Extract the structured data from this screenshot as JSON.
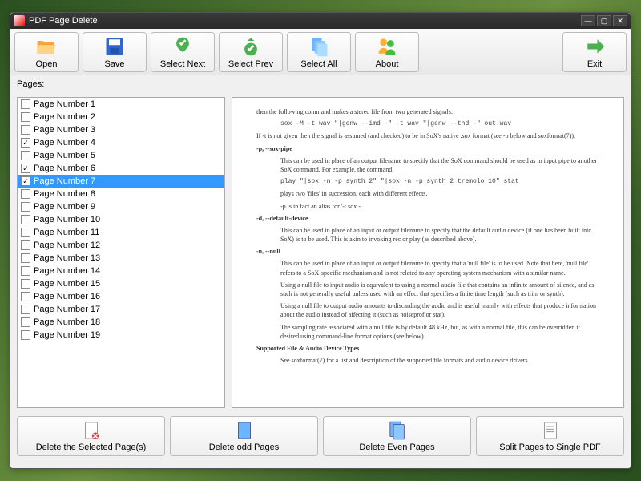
{
  "window": {
    "title": "PDF Page Delete"
  },
  "toolbar": {
    "open": "Open",
    "save": "Save",
    "select_next": "Select Next",
    "select_prev": "Select Prev",
    "select_all": "Select All",
    "about": "About",
    "exit": "Exit"
  },
  "pages_label": "Pages:",
  "pages": [
    {
      "label": "Page Number 1",
      "checked": false,
      "selected": false
    },
    {
      "label": "Page Number 2",
      "checked": false,
      "selected": false
    },
    {
      "label": "Page Number 3",
      "checked": false,
      "selected": false
    },
    {
      "label": "Page Number 4",
      "checked": true,
      "selected": false
    },
    {
      "label": "Page Number 5",
      "checked": false,
      "selected": false
    },
    {
      "label": "Page Number 6",
      "checked": true,
      "selected": false
    },
    {
      "label": "Page Number 7",
      "checked": true,
      "selected": true
    },
    {
      "label": "Page Number 8",
      "checked": false,
      "selected": false
    },
    {
      "label": "Page Number 9",
      "checked": false,
      "selected": false
    },
    {
      "label": "Page Number 10",
      "checked": false,
      "selected": false
    },
    {
      "label": "Page Number 11",
      "checked": false,
      "selected": false
    },
    {
      "label": "Page Number 12",
      "checked": false,
      "selected": false
    },
    {
      "label": "Page Number 13",
      "checked": false,
      "selected": false
    },
    {
      "label": "Page Number 14",
      "checked": false,
      "selected": false
    },
    {
      "label": "Page Number 15",
      "checked": false,
      "selected": false
    },
    {
      "label": "Page Number 16",
      "checked": false,
      "selected": false
    },
    {
      "label": "Page Number 17",
      "checked": false,
      "selected": false
    },
    {
      "label": "Page Number 18",
      "checked": false,
      "selected": false
    },
    {
      "label": "Page Number 19",
      "checked": false,
      "selected": false
    }
  ],
  "preview": {
    "lines": [
      "then the following command makes a stereo file from two generated signals:",
      "sox -M -t wav \"|genw --imd -\" -t wav \"|genw --thd -\" out.wav",
      "If -t is not given then the signal is assumed (and checked) to be in SoX's native .sox format (see -p below and soxformat(7)).",
      "-p, --sox-pipe",
      "This can be used in place of an output filename to specify that the SoX command should be used as in input pipe to another SoX command. For example, the command:",
      "play \"|sox -n -p synth 2\" \"|sox -n -p synth 2 tremolo 10\" stat",
      "plays two 'files' in succession, each with different effects.",
      "-p is in fact an alias for '-t sox -'.",
      "-d, --default-device",
      "This can be used in place of an input or output filename to specify that the default audio device (if one has been built into SoX) is to be used. This is akin to invoking rec or play (as described above).",
      "-n, --null",
      "This can be used in place of an input or output filename to specify that a 'null file' is to be used. Note that here, 'null file' refers to a SoX-specific mechanism and is not related to any operating-system mechanism with a similar name.",
      "Using a null file to input audio is equivalent to using a normal audio file that contains an infinite amount of silence, and as such is not generally useful unless used with an effect that specifies a finite time length (such as trim or synth).",
      "Using a null file to output audio amounts to discarding the audio and is useful mainly with effects that produce information about the audio instead of affecting it (such as noiseprof or stat).",
      "The sampling rate associated with a null file is by default 48 kHz, but, as with a normal file, this can be overridden if desired using command-line format options (see below).",
      "Supported File & Audio Device Types",
      "See soxformat(7) for a list and description of the supported file formats and audio device drivers."
    ]
  },
  "bottombar": {
    "delete_selected": "Delete the Selected Page(s)",
    "delete_odd": "Delete odd Pages",
    "delete_even": "Delete Even Pages",
    "split": "Split Pages to Single PDF"
  }
}
